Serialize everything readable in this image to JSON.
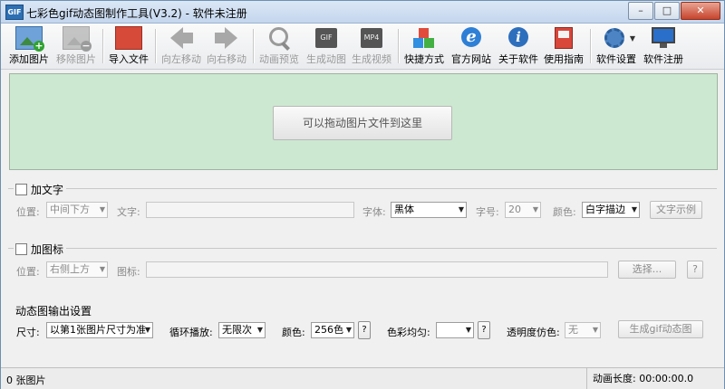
{
  "window": {
    "title": "七彩色gif动态图制作工具(V3.2) - 软件未注册",
    "app_icon_text": "GIF",
    "controls": {
      "minimize": "–",
      "maximize": "□",
      "close": "✕"
    }
  },
  "toolbar": {
    "items": [
      {
        "label": "添加图片",
        "icon": "add-image-icon",
        "enabled": true
      },
      {
        "label": "移除图片",
        "icon": "remove-image-icon",
        "enabled": false
      },
      {
        "label": "导入文件",
        "icon": "import-file-icon",
        "enabled": true
      },
      {
        "label": "向左移动",
        "icon": "arrow-left-icon",
        "enabled": false
      },
      {
        "label": "向右移动",
        "icon": "arrow-right-icon",
        "enabled": false
      },
      {
        "label": "动画预览",
        "icon": "magnifier-icon",
        "enabled": false
      },
      {
        "label": "生成动图",
        "icon": "gif-icon",
        "icon_text": "GIF",
        "enabled": false
      },
      {
        "label": "生成视频",
        "icon": "mp4-icon",
        "icon_text": "MP4",
        "enabled": false
      },
      {
        "label": "快捷方式",
        "icon": "cubes-icon",
        "enabled": true
      },
      {
        "label": "官方网站",
        "icon": "browser-icon",
        "enabled": true
      },
      {
        "label": "关于软件",
        "icon": "info-icon",
        "enabled": true
      },
      {
        "label": "使用指南",
        "icon": "guide-book-icon",
        "enabled": true
      },
      {
        "label": "软件设置",
        "icon": "gear-icon",
        "enabled": true
      },
      {
        "label": "软件注册",
        "icon": "monitor-icon",
        "enabled": true
      }
    ]
  },
  "drop_area": {
    "button_label": "可以拖动图片文件到这里"
  },
  "text_group": {
    "title": "加文字",
    "checked": false,
    "position_label": "位置:",
    "position_value": "中间下方",
    "text_label": "文字:",
    "text_value": "",
    "font_label": "字体:",
    "font_value": "黑体",
    "size_label": "字号:",
    "size_value": "20",
    "color_label": "颜色:",
    "color_value": "白字描边",
    "sample_button": "文字示例"
  },
  "icon_group": {
    "title": "加图标",
    "checked": false,
    "position_label": "位置:",
    "position_value": "右侧上方",
    "icon_label": "图标:",
    "icon_value": "",
    "choose_button": "选择...",
    "help_button": "?"
  },
  "output_group": {
    "title": "动态图输出设置",
    "size_label": "尺寸:",
    "size_value": "以第1张图片尺寸为准",
    "loop_label": "循环播放:",
    "loop_value": "无限次",
    "color_label": "颜色:",
    "color_value": "256色",
    "color_help": "?",
    "uniform_label": "色彩均匀:",
    "uniform_value": "",
    "uniform_help": "?",
    "transparency_label": "透明度仿色:",
    "transparency_value": "无",
    "generate_button": "生成gif动态图"
  },
  "statusbar": {
    "image_count": "0 张图片",
    "duration": "动画长度:  00:00:00.0"
  },
  "colors": {
    "drop_area_bg": "#cde8d1",
    "window_bg": "#f0f0f0"
  }
}
